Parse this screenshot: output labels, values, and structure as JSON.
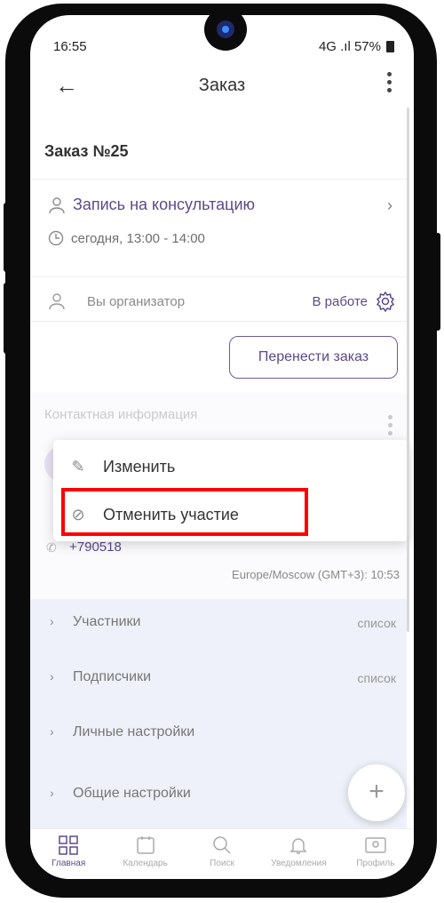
{
  "statusbar": {
    "time": "16:55",
    "right_text": "4G .ıl 57%"
  },
  "appbar": {
    "title": "Заказ",
    "back_glyph": "←"
  },
  "order": {
    "title": "Заказ №25",
    "service": "Запись на консультацию",
    "time": "сегодня, 13:00 - 14:00",
    "organizer": "Вы организатор",
    "status": "В работе",
    "move_button": "Перенести заказ"
  },
  "contact": {
    "title": "Контактная информация",
    "phone": "+790518",
    "timezone": "Europe/Moscow (GMT+3): 10:53"
  },
  "popup_menu": {
    "items": [
      {
        "label": "Изменить",
        "icon": "pencil-icon"
      },
      {
        "label": "Отменить участие",
        "icon": "cancel-icon"
      }
    ]
  },
  "sections": [
    {
      "label": "Участники",
      "value": "список"
    },
    {
      "label": "Подписчики",
      "value": "список"
    },
    {
      "label": "Личные настройки",
      "value": ""
    },
    {
      "label": "Общие настройки",
      "value": ""
    }
  ],
  "fab": {
    "glyph": "+"
  },
  "bottom_nav": [
    {
      "label": "Главная",
      "icon": "home-grid-icon",
      "active": true
    },
    {
      "label": "Календарь",
      "icon": "calendar-icon",
      "active": false
    },
    {
      "label": "Поиск",
      "icon": "search-icon",
      "active": false
    },
    {
      "label": "Уведомления",
      "icon": "bell-icon",
      "active": false
    },
    {
      "label": "Профиль",
      "icon": "profile-icon",
      "active": false
    }
  ],
  "colors": {
    "accent": "#5b4a8b",
    "highlight": "#ff0000",
    "section_bg": "#eef1f9"
  }
}
